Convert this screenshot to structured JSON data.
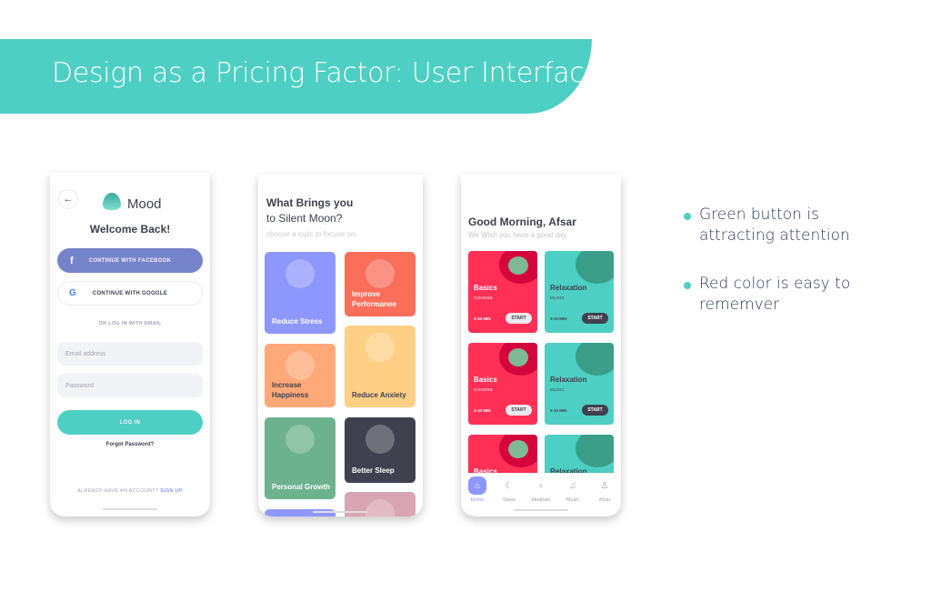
{
  "header": {
    "title": "Design as a Pricing Factor: User Interface"
  },
  "colors": {
    "accent": "#4ecfc3",
    "facebook": "#7583ca",
    "purple": "#8e97fd",
    "red": "#ff2f55",
    "dark": "#3f414e"
  },
  "login": {
    "app_name": "Mood",
    "heading": "Welcome Back!",
    "facebook_label": "CONTINUE WITH FACEBOOK",
    "google_label": "CONTINUE WITH GOOGLE",
    "divider_text": "OR LOG IN WITH EMAIL",
    "email_placeholder": "Email address",
    "password_placeholder": "Password",
    "login_label": "LOG IN",
    "forgot_label": "Forgot Password?",
    "account_text": "ALREADY HAVE AN ACCOUNT?",
    "signup_label": "SIGN UP"
  },
  "topics": {
    "title_line1": "What Brings you",
    "title_line2": "to Silent Moon?",
    "subtitle": "choose a topic to focuse on:",
    "cards": [
      {
        "label": "Reduce Stress",
        "color": "#8e97fd"
      },
      {
        "label": "Improve Performanee",
        "color": "#fa6e5a"
      },
      {
        "label": "Increase Happiness",
        "color": "#ffa978"
      },
      {
        "label": "Reduce Anxiety",
        "color": "#ffcf86"
      },
      {
        "label": "Personal Growth",
        "color": "#6cb28e"
      },
      {
        "label": "Better Sleep",
        "color": "#3f414e"
      },
      {
        "label": "",
        "color": "#d9a5b5"
      },
      {
        "label": "",
        "color": "#8e97fd"
      }
    ]
  },
  "home": {
    "greeting": "Good Morning, Afsar",
    "subtitle": "We Wish you have a good day",
    "cards": [
      {
        "title": "Basics",
        "type": "COURSE",
        "duration": "3-10 MIN",
        "action": "START"
      },
      {
        "title": "Relaxation",
        "type": "MUSIC",
        "duration": "3-10 MIN",
        "action": "START"
      },
      {
        "title": "Basics",
        "type": "COURSE",
        "duration": "3-10 MIN",
        "action": "START"
      },
      {
        "title": "Relaxation",
        "type": "MUSIC",
        "duration": "3-10 MIN",
        "action": "START"
      },
      {
        "title": "Basics"
      },
      {
        "title": "Relaxation"
      }
    ],
    "nav": [
      {
        "label": "Home",
        "icon": "home-icon"
      },
      {
        "label": "Sleep",
        "icon": "moon-icon"
      },
      {
        "label": "Meditate",
        "icon": "meditate-icon"
      },
      {
        "label": "Music",
        "icon": "music-icon"
      },
      {
        "label": "Afsar",
        "icon": "user-icon"
      }
    ]
  },
  "bullets": [
    {
      "text": "Green button is attracting attention"
    },
    {
      "text": "Red color is easy to rememver"
    }
  ]
}
